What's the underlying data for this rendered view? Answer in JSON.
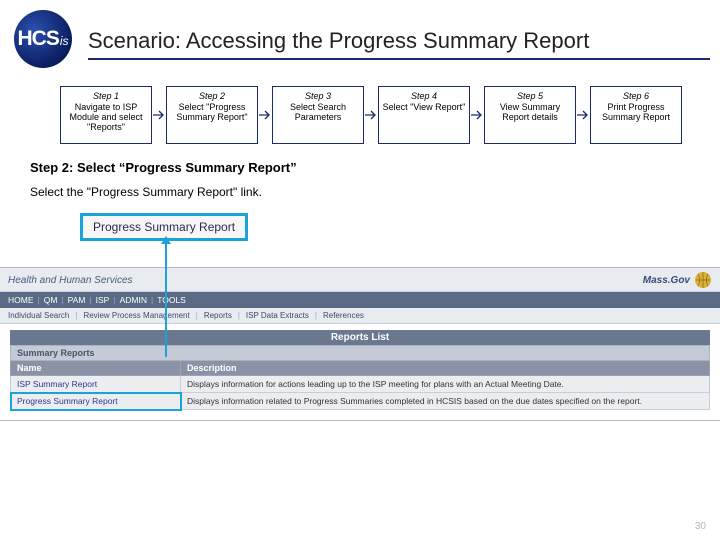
{
  "logo": {
    "main": "HCS",
    "suffix": "is"
  },
  "title": "Scenario: Accessing the Progress Summary Report",
  "steps": [
    {
      "title": "Step 1",
      "desc": "Navigate to ISP Module and select \"Reports\""
    },
    {
      "title": "Step 2",
      "desc": "Select \"Progress Summary Report\""
    },
    {
      "title": "Step 3",
      "desc": "Select Search Parameters"
    },
    {
      "title": "Step 4",
      "desc": "Select \"View Report\""
    },
    {
      "title": "Step 5",
      "desc": "View Summary Report details"
    },
    {
      "title": "Step 6",
      "desc": "Print Progress Summary Report"
    }
  ],
  "current_heading": "Step 2: Select “Progress Summary Report”",
  "instruction": "Select the \"Progress Summary Report\" link.",
  "callout_label": "Progress Summary Report",
  "screenshot": {
    "topbar_title": "Health and Human Services",
    "massgov": "Mass.Gov",
    "menu": [
      "HOME",
      "QM",
      "PAM",
      "ISP",
      "ADMIN",
      "TOOLS"
    ],
    "submenu": [
      "Individual Search",
      "Review Process Management",
      "Reports",
      "ISP Data Extracts",
      "References"
    ],
    "blurb": "Reports List",
    "reports_header": "Reports List",
    "table": {
      "subheader": "Summary Reports",
      "columns": [
        "Name",
        "Description"
      ],
      "rows": [
        {
          "name": "ISP Summary Report",
          "desc": "Displays information for actions leading up to the ISP meeting for plans with an Actual Meeting Date."
        },
        {
          "name": "Progress Summary Report",
          "desc": "Displays information related to Progress Summaries completed in HCSIS based on the due dates specified on the report."
        }
      ]
    }
  },
  "page_number": "30"
}
